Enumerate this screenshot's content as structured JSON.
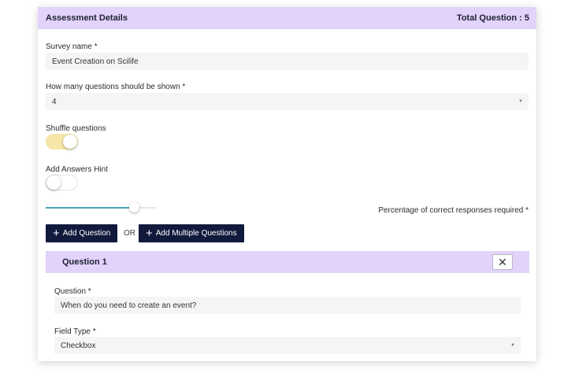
{
  "header": {
    "title": "Assessment Details",
    "total": "Total Question : 5"
  },
  "survey_name": {
    "label": "Survey name *",
    "value": "Event Creation on Scilife"
  },
  "questions_shown": {
    "label": "How many questions should be shown *",
    "value": "4"
  },
  "shuffle": {
    "label": "Shuffle questions",
    "state": "on"
  },
  "answers_hint": {
    "label": "Add Answers Hint",
    "state": "off"
  },
  "correct_responses": {
    "label": "Percentage of correct responses required *",
    "slider_fraction": 0.8
  },
  "actions": {
    "add_question": "Add Question",
    "or": "OR",
    "add_multiple": "Add Multiple Questions"
  },
  "question1": {
    "title": "Question 1",
    "question_label": "Question *",
    "question_value": "When do you need to create an event?",
    "field_type_label": "Field Type *",
    "field_type_value": "Checkbox"
  },
  "colors": {
    "header_bg": "#e2d3fa",
    "button_bg": "#101a3c",
    "toggle_on": "#f5e6a8",
    "slider_fill": "#4aa3b5"
  }
}
